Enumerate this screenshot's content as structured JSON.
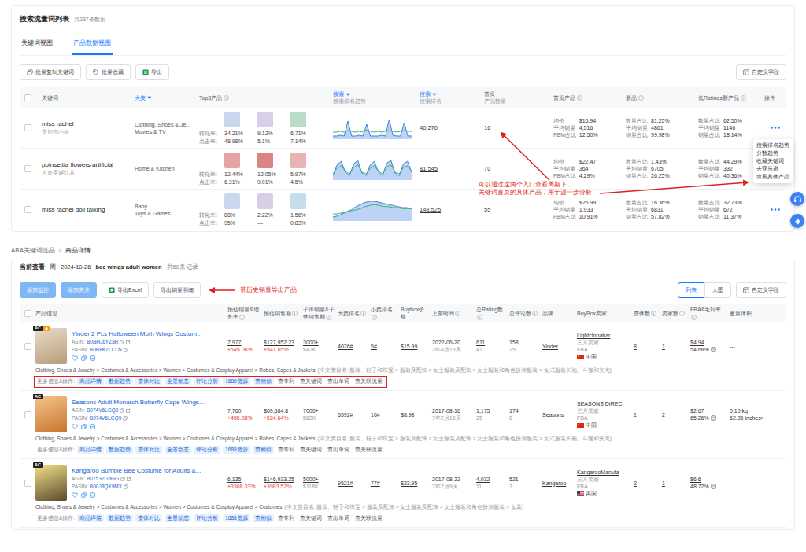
{
  "top": {
    "title": "搜索流量词列表",
    "count": "共237条数据",
    "tabs": [
      {
        "label": "关键词视图",
        "selected": false
      },
      {
        "label": "产品数据视图",
        "selected": true
      }
    ],
    "toolbar": [
      {
        "label": "批量复制关键词",
        "kind": "copy"
      },
      {
        "label": "批量收藏",
        "kind": "tag"
      },
      {
        "label": "导出",
        "kind": "excel"
      }
    ],
    "custom_fields": "自定义字段",
    "columns": [
      {
        "label": "关键词",
        "sub": "",
        "sort": false,
        "info": false
      },
      {
        "label": "大类",
        "sub": "",
        "sort": true,
        "info": false
      },
      {
        "label": "Top3产品",
        "sub": "",
        "sort": false,
        "info": true
      },
      {
        "label": "搜索",
        "sub": "搜索排名趋势",
        "sort": true,
        "info": false
      },
      {
        "label": "搜索",
        "sub": "搜索排名",
        "sort": true,
        "info": false
      },
      {
        "label": "首页",
        "sub": "产品数量",
        "sort": false,
        "info": false
      },
      {
        "label": "首页产品",
        "sub": "",
        "sort": false,
        "info": true
      },
      {
        "label": "新品",
        "sub": "",
        "sort": false,
        "info": true
      },
      {
        "label": "低Ratings新产品",
        "sub": "",
        "sort": false,
        "info": true
      },
      {
        "label": "操作",
        "sub": "",
        "sort": false,
        "info": false
      }
    ],
    "top3_labels": {
      "conversion": "转化率:",
      "click": "点击率:"
    },
    "rows": [
      {
        "keyword": "miss rachel",
        "keyword_cn": "雷切尔小姐",
        "categories": [
          "Clothing, Shoes & Je...",
          "Movies & TV"
        ],
        "conversion": [
          "34.21%",
          "9.12%",
          "6.71%"
        ],
        "click": [
          "48.98%",
          "5.1%",
          "7.14%"
        ],
        "trend": {
          "blue": [
            3,
            3,
            4,
            3,
            22,
            3,
            3,
            4,
            3,
            18,
            3,
            3,
            3,
            4,
            3,
            24,
            4,
            3,
            3,
            20,
            3,
            3
          ],
          "green": [
            8,
            8,
            9,
            8,
            10,
            9,
            8,
            9,
            8,
            11,
            9,
            8,
            9,
            8,
            9,
            10,
            9,
            8,
            9,
            10,
            9,
            9
          ]
        },
        "search_rank": "40,270",
        "home_count": "16",
        "home": [
          {
            "label": "均价",
            "value": "$16.94"
          },
          {
            "label": "平均销量",
            "value": "4,516"
          },
          {
            "label": "FBM占比",
            "value": "12.50%"
          }
        ],
        "new": [
          {
            "label": "数量占比",
            "value": "81.25%"
          },
          {
            "label": "平均销量",
            "value": "4861"
          },
          {
            "label": "销量占比",
            "value": "99.98%"
          }
        ],
        "low": [
          {
            "label": "数量占比",
            "value": "62.50%"
          },
          {
            "label": "平均销量",
            "value": "1146"
          },
          {
            "label": "销量占比",
            "value": "18.14%"
          }
        ],
        "menu_open": true
      },
      {
        "keyword": "poinsettia flowers artificial",
        "keyword_cn": "人造圣诞红花",
        "categories": [
          "Home & Kitchen"
        ],
        "conversion": [
          "12.44%",
          "12.05%",
          "5.97%"
        ],
        "click": [
          "6.31%",
          "9.01%",
          "4.5%"
        ],
        "trend": {
          "blue": [
            4,
            16,
            20,
            8,
            4,
            17,
            21,
            7,
            4,
            16,
            20,
            8,
            4,
            18,
            21,
            7,
            4,
            17,
            20,
            8
          ],
          "green": [
            6,
            12,
            15,
            9,
            6,
            13,
            16,
            8,
            6,
            12,
            15,
            9,
            6,
            14,
            16,
            8,
            6,
            13,
            15,
            9
          ]
        },
        "search_rank": "81,545",
        "home_count": "70",
        "home": [
          {
            "label": "均价",
            "value": "$22.47"
          },
          {
            "label": "平均销量",
            "value": "364"
          },
          {
            "label": "FBM占比",
            "value": "4.29%"
          }
        ],
        "new": [
          {
            "label": "数量占比",
            "value": "1.43%"
          },
          {
            "label": "平均销量",
            "value": "6705"
          },
          {
            "label": "销量占比",
            "value": "26.25%"
          }
        ],
        "low": [
          {
            "label": "数量占比",
            "value": "44.29%"
          },
          {
            "label": "平均销量",
            "value": "332"
          },
          {
            "label": "销量占比",
            "value": "40.36%"
          }
        ],
        "menu_open": false
      },
      {
        "keyword": "miss rachel doll talking",
        "keyword_cn": "",
        "categories": [
          "Baby",
          "Toys & Games"
        ],
        "conversion": [
          "88%",
          "2.22%",
          "1.56%"
        ],
        "click": [
          "95%",
          "---",
          "0.83%"
        ],
        "trend": {
          "blue": [
            3,
            4,
            6,
            8,
            10,
            13,
            15,
            17,
            18,
            18,
            17,
            16,
            15,
            14,
            13,
            12,
            12,
            11
          ],
          "green": [
            6,
            6,
            7,
            8,
            9,
            10,
            11,
            13,
            14,
            15,
            14,
            13,
            13,
            12,
            12,
            11,
            11,
            11
          ]
        },
        "search_rank": "148,525",
        "home_count": "55",
        "home": [
          {
            "label": "均价",
            "value": "$26.99"
          },
          {
            "label": "平均销量",
            "value": "1,933"
          },
          {
            "label": "FBM占比",
            "value": "10.91%"
          }
        ],
        "new": [
          {
            "label": "数量占比",
            "value": "16.36%"
          },
          {
            "label": "平均销量",
            "value": "6831"
          },
          {
            "label": "销量占比",
            "value": "57.82%"
          }
        ],
        "low": [
          {
            "label": "数量占比",
            "value": "32.73%"
          },
          {
            "label": "平均销量",
            "value": "672"
          },
          {
            "label": "销量占比",
            "value": "11.37%"
          }
        ],
        "menu_open": false
      }
    ],
    "menu": [
      "搜索排名趋势",
      "分数趋势",
      "收藏关键词",
      "去亚马逊",
      "查看具体产品"
    ],
    "annotation": [
      "可以通过这两个入口查看周期下，",
      "关键词首页的具体产品，用于进一步分析"
    ]
  },
  "bottom": {
    "breadcrumb": [
      "ABA关键词选品",
      "商品详情"
    ],
    "separator": ">",
    "info": {
      "label": "当前查看",
      "period": "周",
      "date": "2024-10-26",
      "keyword": "bee wings adult women",
      "count": "共58条记录"
    },
    "buttons": [
      {
        "label": "添加监控",
        "kind": "primary",
        "disabled": true
      },
      {
        "label": "添加关注",
        "kind": "primary",
        "disabled": true
      },
      {
        "label": "导出Excel",
        "kind": "excel",
        "disabled": false
      },
      {
        "label": "导出销量明细",
        "kind": "plain",
        "disabled": false
      }
    ],
    "annotation": "带历史销量导出产品",
    "views": [
      {
        "label": "列表",
        "selected": true
      },
      {
        "label": "大图",
        "selected": false
      }
    ],
    "custom_fields": "自定义字段",
    "columns": [
      {
        "label": "产品信息",
        "info": false
      },
      {
        "label": "预估销量&增长率",
        "info": true
      },
      {
        "label": "预估销售额",
        "info": true
      },
      {
        "label": "子体销量&子体销售额",
        "info": true
      },
      {
        "label": "大类排名",
        "info": true
      },
      {
        "label": "小类排名",
        "info": true
      },
      {
        "label": "Buybox价格",
        "info": false
      },
      {
        "label": "上架时间",
        "info": true
      },
      {
        "label": "总Rating数",
        "info": true
      },
      {
        "label": "总评论数",
        "info": true
      },
      {
        "label": "品牌",
        "info": false
      },
      {
        "label": "BuyBox卖家",
        "info": false
      },
      {
        "label": "变体数",
        "info": true
      },
      {
        "label": "卖家数",
        "info": true
      },
      {
        "label": "FBA&毛利率",
        "info": true
      },
      {
        "label": "重量体积",
        "info": false
      }
    ],
    "asin_label": "ASIN:",
    "pasin_label": "PASIN:",
    "tags_label": "更多信息&操作:",
    "tags": [
      {
        "label": "商品详情",
        "kind": "tag"
      },
      {
        "label": "数据趋势",
        "kind": "tag"
      },
      {
        "label": "变体对比",
        "kind": "tag"
      },
      {
        "label": "全景动态",
        "kind": "tag"
      },
      {
        "label": "评论分析",
        "kind": "tag"
      },
      {
        "label": "1688货源",
        "kind": "tag"
      },
      {
        "label": "查相似",
        "kind": "tag"
      },
      {
        "label": "查专利",
        "kind": "plain"
      },
      {
        "label": "查关键词",
        "kind": "plain"
      },
      {
        "label": "查出单词",
        "kind": "plain"
      },
      {
        "label": "查关联流量",
        "kind": "plain"
      }
    ],
    "products": [
      {
        "title": "Yinder 2 Pcs Halloween Moth Wings Costum...",
        "asin": "B0BHJ6YZ8R",
        "pasin": "B0B8KZLCLN",
        "badges": [
          "AC"
        ],
        "hot": true,
        "sales": "7,977",
        "sales_growth": "+549.06%",
        "revenue": "$127,952.23",
        "revenue_growth": "+541.65%",
        "child_sales": "3000+",
        "child_revenue": "$47K",
        "main_rank": "4026#",
        "sub_rank": "5#",
        "price": "$15.99",
        "listed_date": "2022-06-20",
        "listed_age": "2年4月15天",
        "ratings": "611",
        "ratings_sub": "41",
        "reviews": "158",
        "reviews_sub": "25",
        "brand": "Yinder",
        "seller": {
          "name": "LightcInnabar",
          "type": "三方卖家",
          "fulfil": "FBA",
          "country": "中国",
          "flag": "cn"
        },
        "variants": "8",
        "sellers": "1",
        "fba_fee": "$4.94",
        "margin": "54.68%",
        "weight": [
          "---"
        ],
        "category": "Clothing, Shoes & Jewelry > Costumes & Accessories > Women > Costumes & Cosplay Apparel > Robes, Capes & Jackets",
        "category_cn": "(中文类目名: 服装、鞋子和珠宝 > 服装及配饰 > 女士服装及配饰 > 女士服装和角色扮演服装 > 女式服装长袍、斗篷和夹克)",
        "annotated": true
      },
      {
        "title": "Seasons Adult Monarch Butterfly Cape Wings...",
        "asin": "B074V6LGQ9",
        "pasin": "B074V6LGQ9",
        "badges": [
          "AC"
        ],
        "hot": false,
        "sales": "7,760",
        "sales_growth": "+455.08%",
        "revenue": "$69,684.8",
        "revenue_growth": "+524.64%",
        "child_sales": "7000+",
        "child_revenue": "$62K",
        "main_rank": "6592#",
        "sub_rank": "10#",
        "price": "$8.98",
        "listed_date": "2017-08-16",
        "listed_age": "7年2月15天",
        "ratings": "1,175",
        "ratings_sub": "25",
        "reviews": "174",
        "reviews_sub": "8",
        "brand": "Seasons",
        "seller": {
          "name": "SEASONS DIREC",
          "type": "三方卖家",
          "fulfil": "FBA",
          "country": "中国",
          "flag": "cn"
        },
        "variants": "1",
        "sellers": "2",
        "fba_fee": "$2.67",
        "margin": "65.26%",
        "weight": [
          "0.10 kg",
          "62.35 inches³"
        ],
        "category": "Clothing, Shoes & Jewelry > Costumes & Accessories > Women > Costumes & Cosplay Apparel > Robes, Capes & Jackets",
        "category_cn": "(中文类目名: 服装、鞋子和珠宝 > 服装及配饰 > 女士服装及配饰 > 女士服装和角色扮演服装 > 女式服装长袍、斗篷和夹克)",
        "annotated": false
      },
      {
        "title": "Kangaroo Bumble Bee Costume for Adults &...",
        "asin": "B07532G5GG",
        "pasin": "B00J8QX9MX",
        "badges": [
          "AC"
        ],
        "hot": false,
        "sales": "6,135",
        "sales_growth": "+3308.33%",
        "revenue": "$146,933.25",
        "revenue_growth": "+3983.52%",
        "child_sales": "5000+",
        "child_revenue": "$118K",
        "main_rank": "9521#",
        "sub_rank": "77#",
        "price": "$23.95",
        "listed_date": "2017-08-22",
        "listed_age": "7年2月9天",
        "ratings": "4,032",
        "ratings_sub": "11",
        "reviews": "521",
        "reviews_sub": "7",
        "brand": "Kangaroo",
        "seller": {
          "name": "KangarooManufa",
          "type": "三方卖家",
          "fulfil": "FBA",
          "country": "美国",
          "flag": "us"
        },
        "variants": "2",
        "sellers": "1",
        "fba_fee": "$6.6",
        "margin": "48.72%",
        "weight": [
          "---"
        ],
        "category": "Clothing, Shoes & Jewelry > Costumes & Accessories > Women > Costumes & Cosplay Apparel > Costumes",
        "category_cn": "(中文类目名: 服装、鞋子和珠宝 > 服装及配饰 > 女士服装及配饰 > 女士服装和角色扮演服装 > 女装)",
        "annotated": false
      }
    ]
  }
}
